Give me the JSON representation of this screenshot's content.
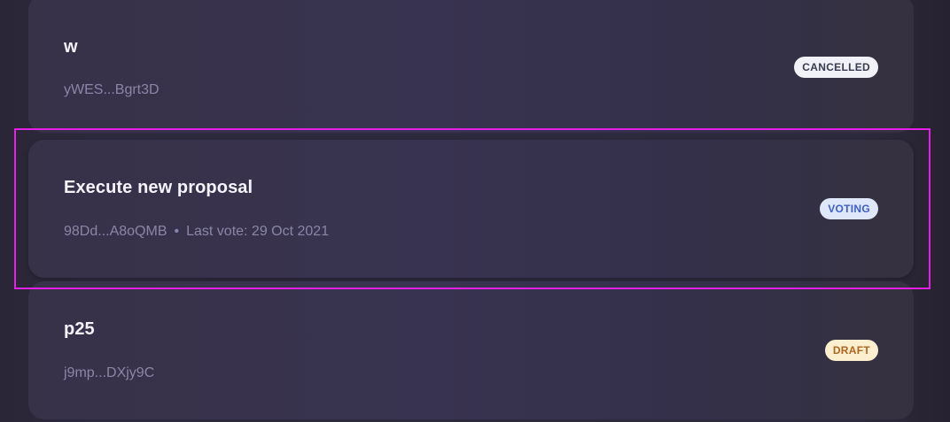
{
  "proposals": [
    {
      "title": "w",
      "address": "yWES...Bgrt3D",
      "last_vote": "",
      "status": "CANCELLED"
    },
    {
      "title": "Execute new proposal",
      "address": "98Dd...A8oQMB",
      "separator": "•",
      "last_vote": "Last vote: 29 Oct 2021",
      "status": "VOTING"
    },
    {
      "title": "p25",
      "address": "j9mp...DXjy9C",
      "last_vote": "",
      "status": "DRAFT"
    }
  ],
  "colors": {
    "highlight_border": "#e321e4",
    "cancelled_badge_bg": "#f1f2f7",
    "voting_badge_bg": "#dfe7fb",
    "voting_badge_text": "#3e5fc7",
    "draft_badge_bg": "#fbefcf",
    "draft_badge_text": "#b0651c"
  }
}
